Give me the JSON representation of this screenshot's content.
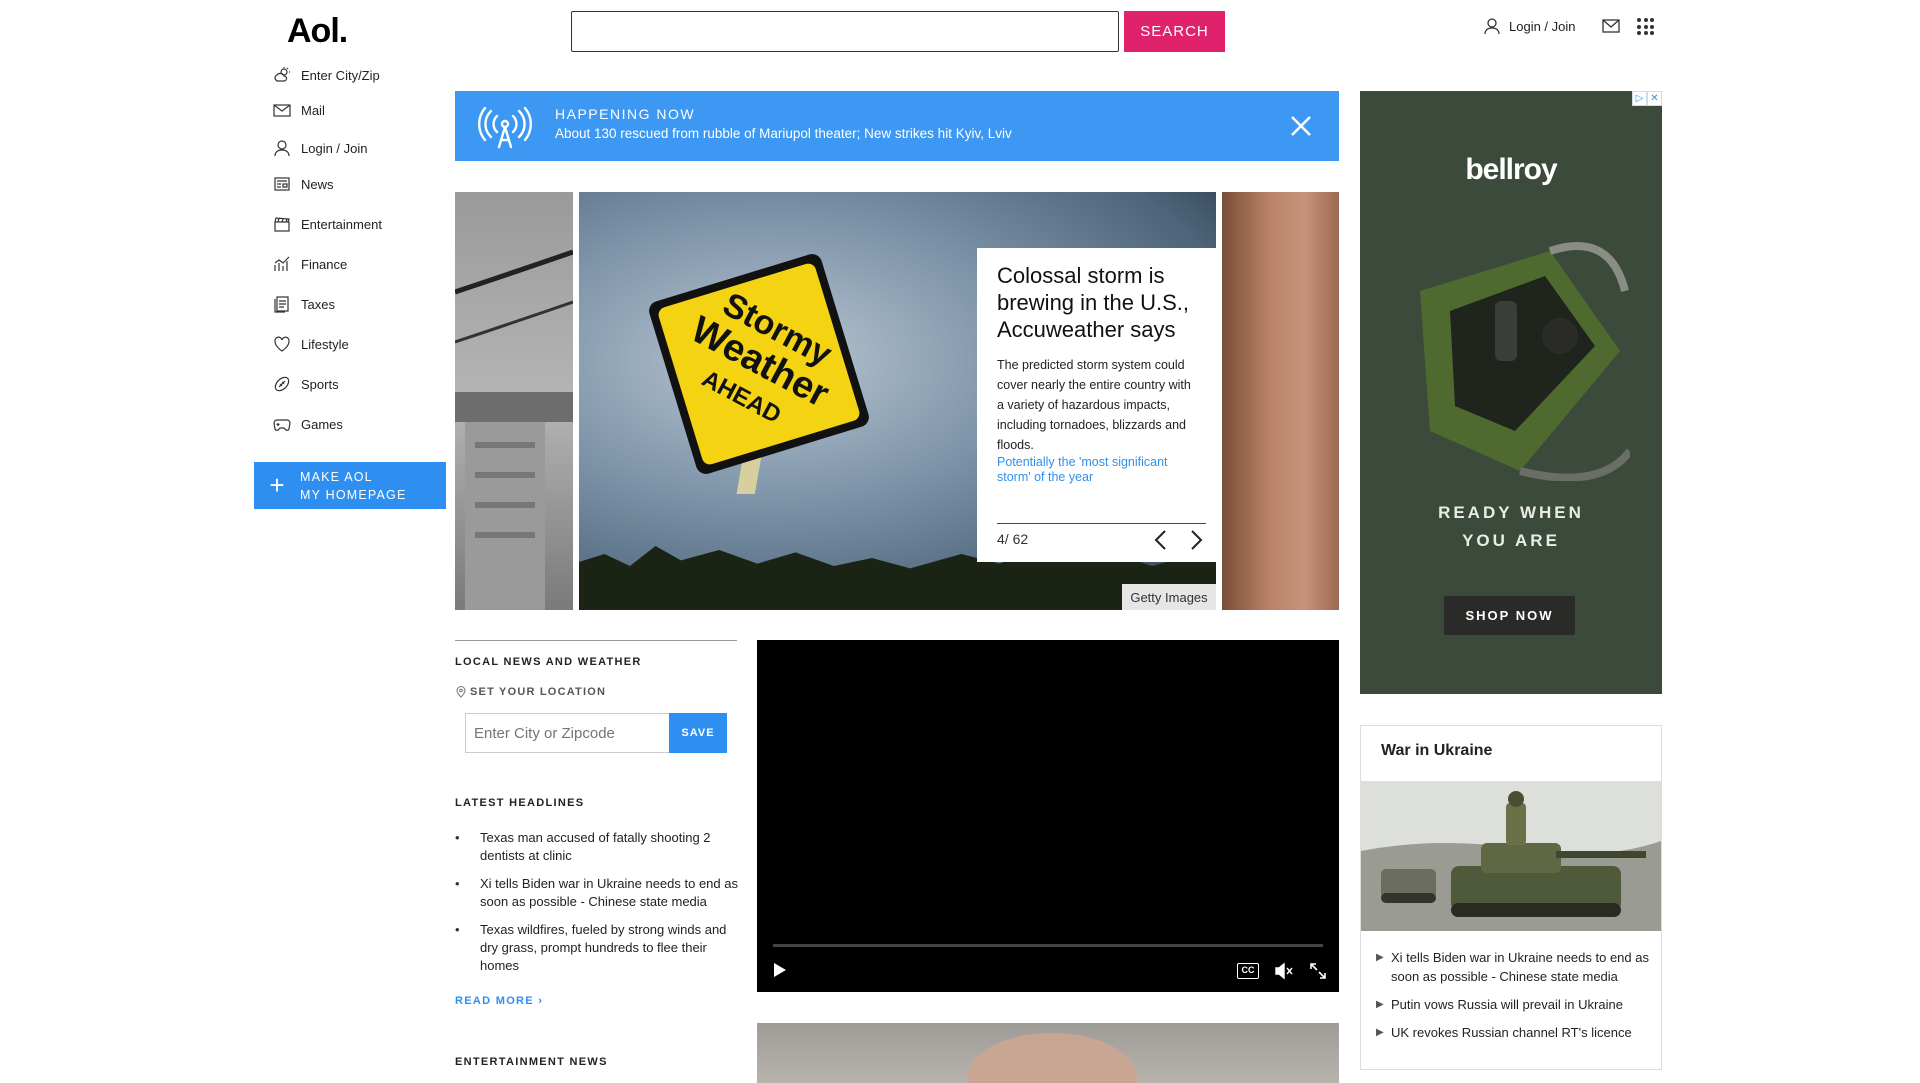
{
  "header": {
    "logo": "Aol.",
    "search_placeholder": "",
    "search_button": "SEARCH",
    "login_label": "Login / Join"
  },
  "sidebar": {
    "items": [
      {
        "label": "Enter City/Zip",
        "icon": "weather-icon"
      },
      {
        "label": "Mail",
        "icon": "mail-icon"
      },
      {
        "label": "Login / Join",
        "icon": "user-icon"
      },
      {
        "label": "News",
        "icon": "news-icon"
      },
      {
        "label": "Entertainment",
        "icon": "clapperboard-icon"
      },
      {
        "label": "Finance",
        "icon": "chart-icon"
      },
      {
        "label": "Taxes",
        "icon": "document-icon"
      },
      {
        "label": "Lifestyle",
        "icon": "heart-icon"
      },
      {
        "label": "Sports",
        "icon": "football-icon"
      },
      {
        "label": "Games",
        "icon": "gamepad-icon"
      }
    ],
    "make_home_line1": "MAKE AOL",
    "make_home_line2": "MY HOMEPAGE"
  },
  "happening": {
    "title": "HAPPENING NOW",
    "text": "About 130 rescued from rubble of Mariupol theater; New strikes hit Kyiv, Lviv"
  },
  "carousel": {
    "sign_line1": "Stormy",
    "sign_line2": "Weather",
    "sign_line3": "AHEAD",
    "title": "Colossal storm is brewing in the U.S., Accuweather says",
    "body": "The predicted storm system could cover nearly the entire country with a variety of hazardous impacts, including tornadoes, blizzards and floods.",
    "link": "Potentially the 'most significant storm' of the year",
    "counter": "4/ 62",
    "credit": "Getty Images"
  },
  "ad": {
    "badge_left": "▷",
    "badge_right": "✕",
    "brand": "bellroy",
    "tagline_line1": "READY WHEN",
    "tagline_line2": "YOU ARE",
    "cta": "SHOP NOW"
  },
  "local": {
    "heading": "LOCAL NEWS AND WEATHER",
    "set_location": "SET YOUR LOCATION",
    "input_placeholder": "Enter City or Zipcode",
    "save": "SAVE"
  },
  "latest": {
    "heading": "LATEST HEADLINES",
    "items": [
      "Texas man accused of fatally shooting 2 dentists at clinic",
      "Xi tells Biden war in Ukraine needs to end as soon as possible - Chinese state media",
      "Texas wildfires, fueled by strong winds and dry grass, prompt hundreds to flee their homes"
    ],
    "read_more": "READ MORE ›"
  },
  "entertainment_heading": "ENTERTAINMENT NEWS",
  "video": {
    "cc": "CC"
  },
  "ukraine": {
    "title": "War in Ukraine",
    "items": [
      "Xi tells Biden war in Ukraine needs to end as soon as possible - Chinese state media",
      "Putin vows Russia will prevail in Ukraine",
      "UK revokes Russian channel RT's licence"
    ]
  },
  "colors": {
    "search_button": "#e0226c",
    "accent_blue": "#2f8ff0",
    "happening_bg": "#3c98f3",
    "ad_bg": "#3b4a3a"
  }
}
